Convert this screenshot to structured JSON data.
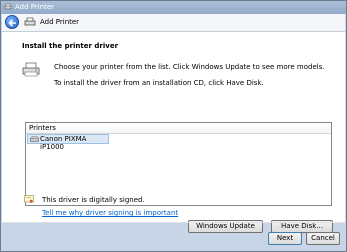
{
  "window": {
    "title": "Add Printer"
  },
  "header": {
    "title": "Add Printer"
  },
  "main": {
    "section_title": "Install the printer driver",
    "description_1": "Choose your printer from the list. Click Windows Update to see more models.",
    "description_2": "To install the driver from an installation CD, click Have Disk."
  },
  "printers_list": {
    "header": "Printers",
    "items": [
      {
        "label": "Canon PIXMA iP1000",
        "selected": true
      }
    ]
  },
  "signature": {
    "status_text": "This driver is digitally signed.",
    "link_text": "Tell me why driver signing is important"
  },
  "buttons": {
    "windows_update": "Windows Update",
    "have_disk": "Have Disk...",
    "next": "Next",
    "cancel": "Cancel"
  },
  "icons": {
    "title": "printer-icon",
    "back": "back-arrow-icon",
    "header": "printer-icon",
    "signed": "certificate-icon"
  }
}
